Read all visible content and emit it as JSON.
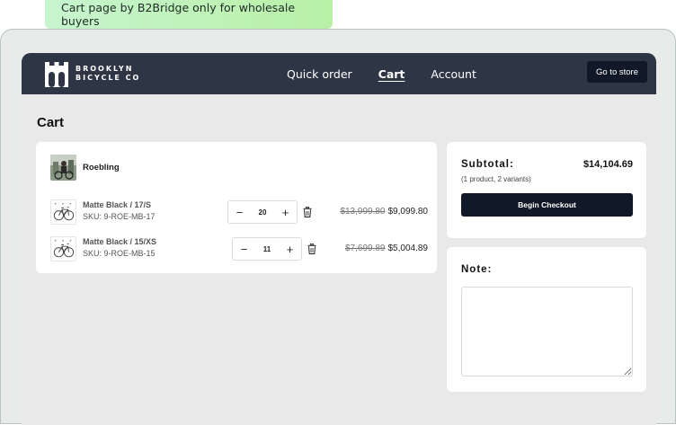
{
  "banner": {
    "text": "Cart page by B2Bridge only for wholesale buyers"
  },
  "header": {
    "logo_line1": "BROOKLYN",
    "logo_line2": "BICYCLE CO",
    "nav": [
      {
        "label": "Quick order",
        "active": false
      },
      {
        "label": "Cart",
        "active": true
      },
      {
        "label": "Account",
        "active": false
      }
    ],
    "store_button": "Go to store"
  },
  "page": {
    "title": "Cart"
  },
  "cart": {
    "product_name": "Roebling",
    "variants": [
      {
        "title": "Matte Black / 17/S",
        "sku": "SKU: 9-ROE-MB-17",
        "qty": "20",
        "old_price": "$13,999.80",
        "price": "$9,099.80"
      },
      {
        "title": "Matte Black / 15/XS",
        "sku": "SKU: 9-ROE-MB-15",
        "qty": "11",
        "old_price": "$7,699.89",
        "price": "$5,004.89"
      }
    ],
    "minus_symbol": "−",
    "plus_symbol": "+"
  },
  "summary": {
    "subtotal_label": "Subtotal:",
    "subtotal_value": "$14,104.69",
    "meta": "(1 product, 2 variants)",
    "checkout": "Begin Checkout"
  },
  "note": {
    "label": "Note:"
  },
  "colors": {
    "navbar": "#2e3646",
    "button_dark": "#111827",
    "banner": "#c7f5cf"
  },
  "icons": [
    "logo-bridge-icon",
    "minus-icon",
    "plus-icon",
    "trash-icon",
    "bicycle-icon"
  ]
}
